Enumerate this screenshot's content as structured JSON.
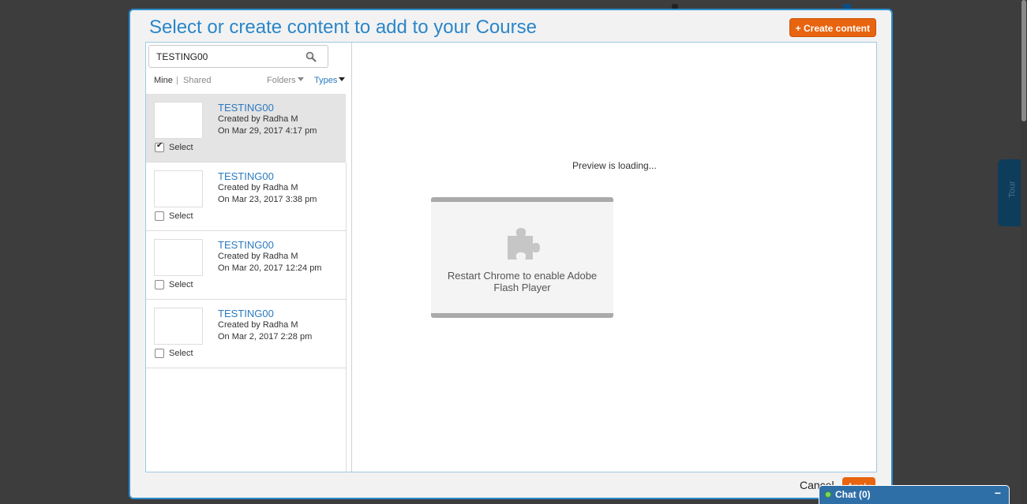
{
  "modal": {
    "title": "Select or create content to add to your Course",
    "create_button": "+ Create content"
  },
  "search": {
    "value": "TESTING00",
    "icon": "search-icon"
  },
  "filters": {
    "mine": "Mine",
    "separator": "|",
    "shared": "Shared",
    "folders": "Folders",
    "types": "Types"
  },
  "items": [
    {
      "title": "TESTING00",
      "created_by": "Created by Radha M",
      "date": "On Mar 29, 2017 4:17 pm",
      "select_label": "Select",
      "checked": true
    },
    {
      "title": "TESTING00",
      "created_by": "Created by Radha M",
      "date": "On Mar 23, 2017 3:38 pm",
      "select_label": "Select",
      "checked": false
    },
    {
      "title": "TESTING00",
      "created_by": "Created by Radha M",
      "date": "On Mar 20, 2017 12:24 pm",
      "select_label": "Select",
      "checked": false
    },
    {
      "title": "TESTING00",
      "created_by": "Created by Radha M",
      "date": "On Mar 2, 2017 2:28 pm",
      "select_label": "Select",
      "checked": false
    }
  ],
  "preview": {
    "status": "Preview is loading...",
    "plugin_message": "Restart Chrome to enable Adobe Flash Player",
    "plugin_icon": "puzzle-piece-icon"
  },
  "footer": {
    "cancel": "Cancel",
    "apply": "Apply"
  },
  "tour": {
    "label": "Tour"
  },
  "chat": {
    "label": "Chat  (0)",
    "minimize": "−"
  },
  "colors": {
    "accent": "#2a86c9",
    "button_orange": "#e8640f",
    "chat_blue": "#2f6fa8"
  }
}
